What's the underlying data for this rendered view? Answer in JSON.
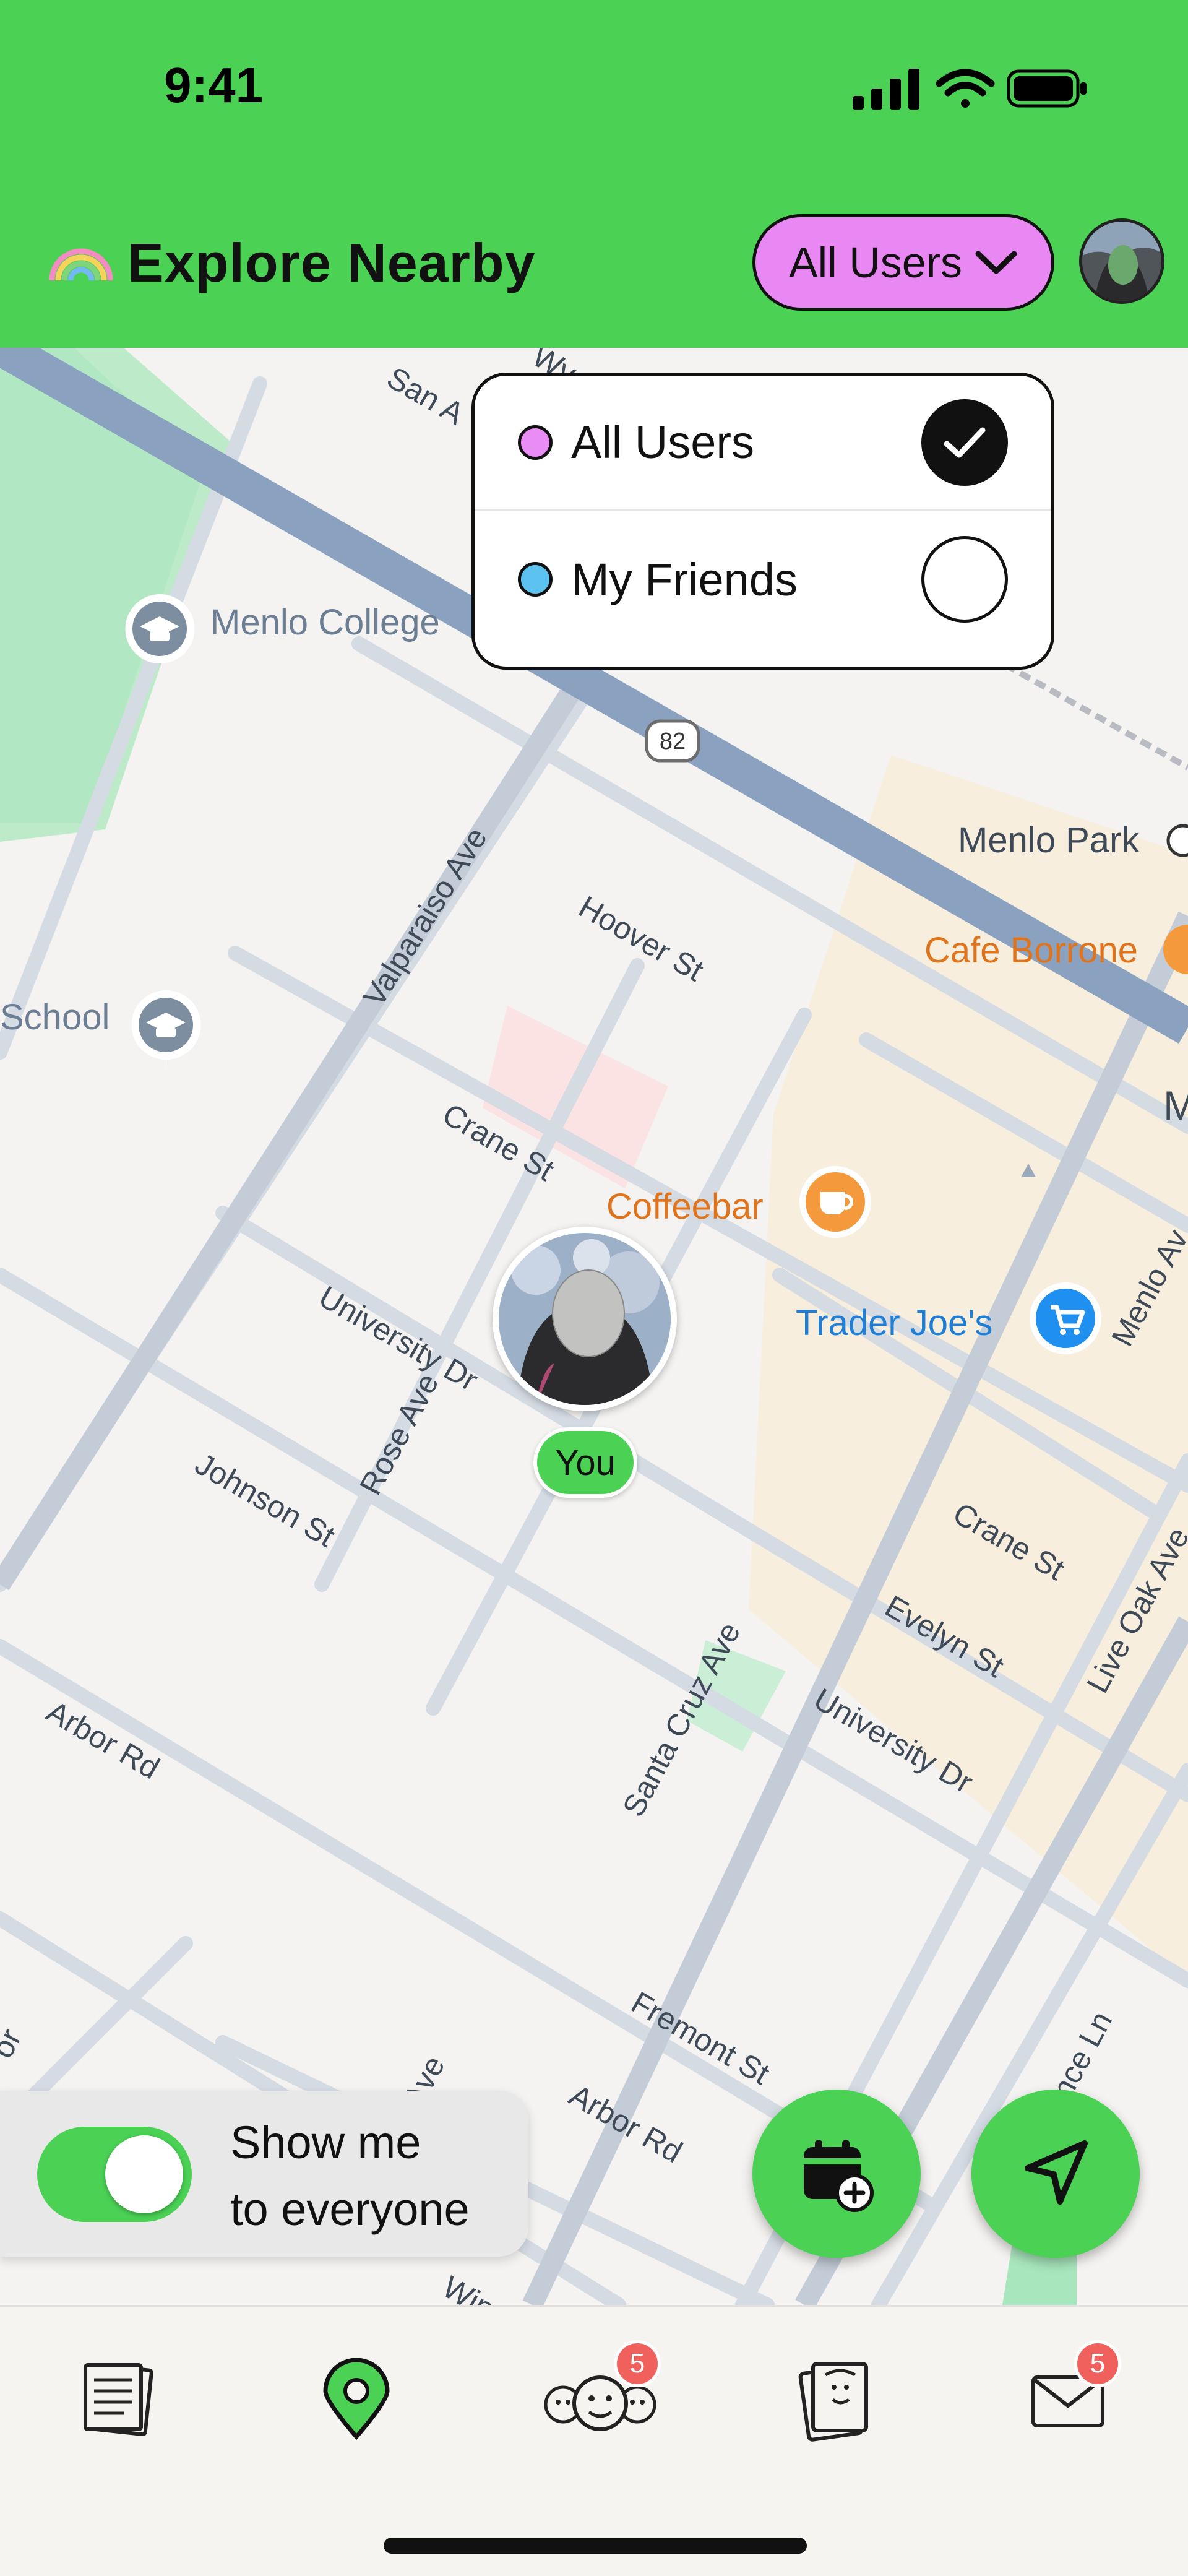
{
  "status_bar": {
    "time": "9:41"
  },
  "header": {
    "title": "Explore Nearby",
    "filter_label": "All Users"
  },
  "filter_menu": {
    "options": [
      {
        "label": "All Users",
        "dot_color": "#e98cf5",
        "selected": true
      },
      {
        "label": "My Friends",
        "dot_color": "#5cc3f0",
        "selected": false
      }
    ]
  },
  "map": {
    "pois": {
      "menlo_college": "Menlo College",
      "school": "School",
      "menlo_park": "Menlo Park",
      "cafe_borrone": "Cafe Borrone",
      "coffeebar": "Coffeebar",
      "trader_joes": "Trader Joe's",
      "m_partial": "M"
    },
    "streets": {
      "san_antonio": "San A",
      "wy": "Wy",
      "valparaiso": "Valparaiso Ave",
      "hoover": "Hoover St",
      "crane_1": "Crane St",
      "university_1": "University Dr",
      "rose": "Rose Ave",
      "johnson": "Johnson St",
      "arbor_1": "Arbor Rd",
      "santa_cruz": "Santa Cruz Ave",
      "crane_2": "Crane St",
      "evelyn": "Evelyn St",
      "university_2": "University Dr",
      "live_oak": "Live Oak Ave",
      "menlo_ave": "Menlo Av",
      "fremont": "Fremont St",
      "arbor_2": "Arbor Rd",
      "ave": "Ave",
      "win": "Win",
      "or": "or",
      "ence_ln": "ence Ln"
    },
    "highway_shield": "82",
    "user_pin_label": "You"
  },
  "visibility": {
    "label_line1": "Show me",
    "label_line2": "to everyone",
    "enabled": true
  },
  "tab_bar": {
    "friends_badge": "5",
    "inbox_badge": "5"
  },
  "colors": {
    "brand_green": "#4bd255",
    "filter_pink": "#ea88f3",
    "badge_red": "#f0605c"
  }
}
